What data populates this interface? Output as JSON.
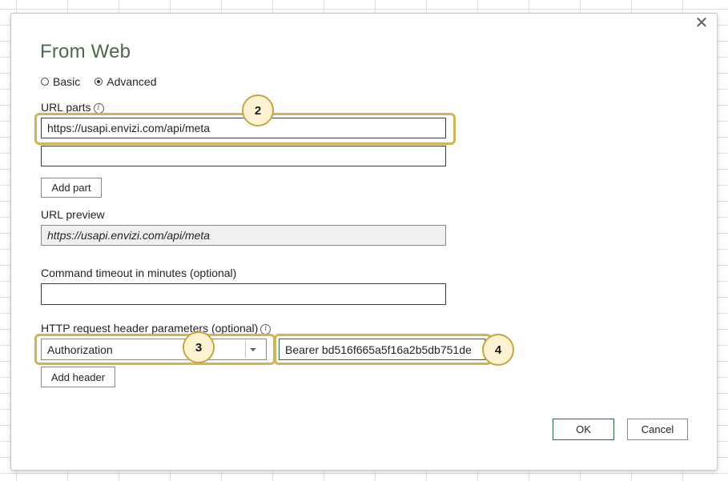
{
  "dialog": {
    "title": "From Web",
    "close_glyph": "✕"
  },
  "mode": {
    "basic_label": "Basic",
    "advanced_label": "Advanced",
    "selected": "Advanced"
  },
  "url_parts": {
    "label": "URL parts",
    "info_glyph": "i",
    "part1_value": "https://usapi.envizi.com/api/meta",
    "part2_value": "",
    "add_part_label": "Add part"
  },
  "url_preview": {
    "label": "URL preview",
    "value": "https://usapi.envizi.com/api/meta"
  },
  "timeout": {
    "label": "Command timeout in minutes (optional)",
    "value": ""
  },
  "headers": {
    "label": "HTTP request header parameters (optional)",
    "info_glyph": "i",
    "name_value": "Authorization",
    "value_value": "Bearer bd516f665a5f16a2b5db751de",
    "add_header_label": "Add header"
  },
  "footer": {
    "ok_label": "OK",
    "cancel_label": "Cancel"
  },
  "callouts": {
    "c2": "2",
    "c3": "3",
    "c4": "4"
  },
  "colors": {
    "title": "#4a6a4a",
    "highlight": "#d4b450",
    "callout_fill": "#fdf3d3",
    "ok_border": "#1f6f43"
  }
}
